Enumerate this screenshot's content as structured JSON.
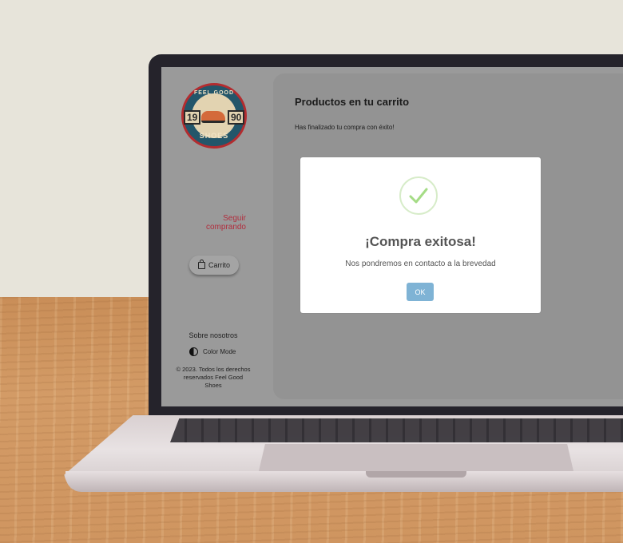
{
  "sidebar": {
    "logo": {
      "top_text": "FEEL GOOD",
      "bottom_text": "SHOES",
      "year_left": "19",
      "year_right": "90"
    },
    "continue_link": "Seguir comprando",
    "cart_button": "Carrito",
    "about_link": "Sobre nosotros",
    "color_mode": "Color Mode",
    "copyright": "© 2023. Todos los derechos reservados Feel Good Shoes"
  },
  "main": {
    "title": "Productos en tu carrito",
    "subtitle": "Has finalizado tu compra con éxito!"
  },
  "modal": {
    "title": "¡Compra exitosa!",
    "message": "Nos pondremos en contacto a la brevedad",
    "ok_label": "OK",
    "icon": "success-check-icon"
  },
  "colors": {
    "accent_link": "#b12e3e",
    "ok_button": "#7fb3d5",
    "success": "#a5dc86"
  }
}
